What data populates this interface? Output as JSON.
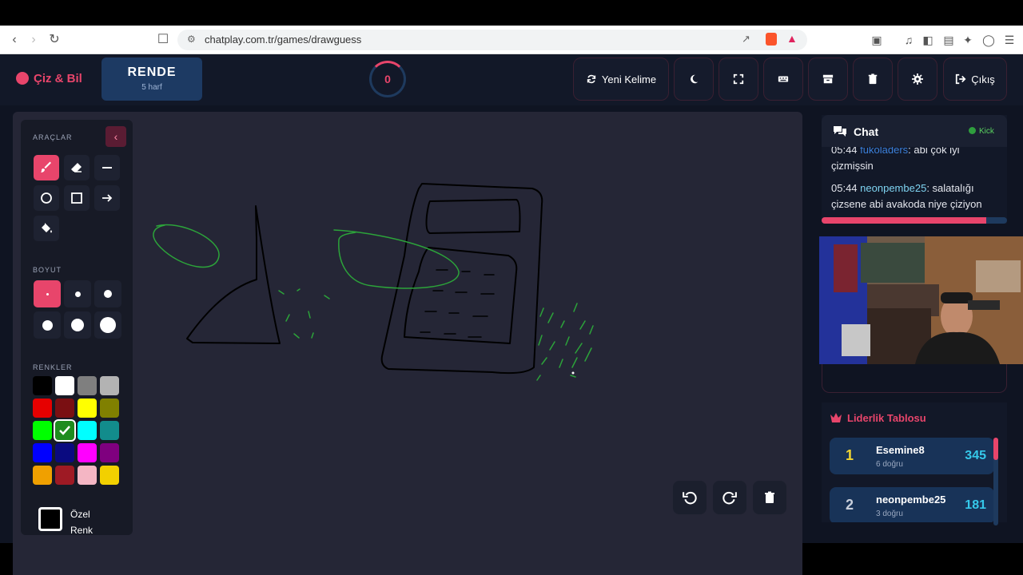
{
  "browser": {
    "url": "chatplay.com.tr/games/drawguess"
  },
  "app": {
    "brand": "Çiz & Bil",
    "word": "RENDE",
    "word_hint": "5 harf",
    "timer": "0",
    "buttons": {
      "new_word": "Yeni Kelime",
      "exit": "Çıkış"
    }
  },
  "tools": {
    "section_tools": "ARAÇLAR",
    "section_size": "BOYUT",
    "section_colors": "RENKLER",
    "custom_color_label_1": "Özel",
    "custom_color_label_2": "Renk",
    "colors": [
      "#000000",
      "#ffffff",
      "#7f7f7f",
      "#b3b3b3",
      "#e60000",
      "#7a0f12",
      "#ffff00",
      "#808000",
      "#00ff00",
      "#1e8c1e",
      "#00ffff",
      "#128c8c",
      "#0000ff",
      "#0a0a80",
      "#ff00ff",
      "#7f007f",
      "#f0a000",
      "#9e1a24",
      "#f4b6c4",
      "#f2d000"
    ]
  },
  "chat": {
    "title": "Chat",
    "platform": "Kick",
    "messages": [
      {
        "time": "05:44",
        "user": "fukoladers",
        "text": ": abi çok iyi çizmişsin"
      },
      {
        "time": "05:44",
        "user": "neonpembe25",
        "text": ": salatalığı çizsene abi avakoda niye çiziyon"
      }
    ],
    "progress": 0.89
  },
  "leaderboard": {
    "title": "Liderlik Tablosu",
    "rows": [
      {
        "rank": "1",
        "name": "Esemine8",
        "sub": "6 doğru",
        "score": "345"
      },
      {
        "rank": "2",
        "name": "neonpembe25",
        "sub": "3 doğru",
        "score": "181"
      }
    ]
  },
  "colors": {
    "accent": "#e8456b",
    "background": "#0f1422",
    "canvas": "#252636",
    "score": "#35c8ea"
  }
}
